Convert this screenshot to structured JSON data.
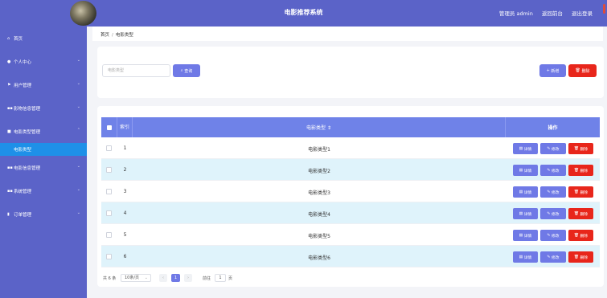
{
  "header": {
    "title": "电影推荐系统",
    "admin_label": "管理员 admin",
    "back_label": "返回前台",
    "logout_label": "退出登录"
  },
  "sidebar": {
    "items": [
      {
        "label": "首页",
        "icon": "home-icon"
      },
      {
        "label": "个人中心",
        "icon": "user-icon"
      },
      {
        "label": "用户管理",
        "icon": "flag-icon"
      },
      {
        "label": "影物信息管理",
        "icon": "grid-icon"
      },
      {
        "label": "电影类型管理",
        "icon": "folder-icon"
      },
      {
        "label": "电影类型",
        "active": true
      },
      {
        "label": "电影信息管理",
        "icon": "grid-icon"
      },
      {
        "label": "系统管理",
        "icon": "grid-icon"
      },
      {
        "label": "订单管理",
        "icon": "chart-icon"
      }
    ]
  },
  "breadcrumb": {
    "home": "首页",
    "separator": "/",
    "current": "电影类型"
  },
  "search": {
    "placeholder": "电影类型",
    "search_label": "查询",
    "add_label": "新增",
    "delete_label": "删除"
  },
  "table": {
    "headers": {
      "index": "索引",
      "type": "电影类型 ⇕",
      "ops": "操作"
    },
    "rows": [
      {
        "index": "1",
        "type": "电影类型1"
      },
      {
        "index": "2",
        "type": "电影类型2"
      },
      {
        "index": "3",
        "type": "电影类型3"
      },
      {
        "index": "4",
        "type": "电影类型4"
      },
      {
        "index": "5",
        "type": "电影类型5"
      },
      {
        "index": "6",
        "type": "电影类型6"
      }
    ],
    "row_actions": {
      "detail": "详情",
      "edit": "修改",
      "delete": "删除"
    }
  },
  "pagination": {
    "total": "共 6 条",
    "page_size": "10条/页",
    "current_page": "1",
    "goto_label": "前往",
    "goto_value": "1",
    "unit": "页"
  },
  "colors": {
    "primary": "#5b63c8",
    "accent": "#6f79e6",
    "danger": "#e8261b",
    "active": "#1e90e8"
  }
}
